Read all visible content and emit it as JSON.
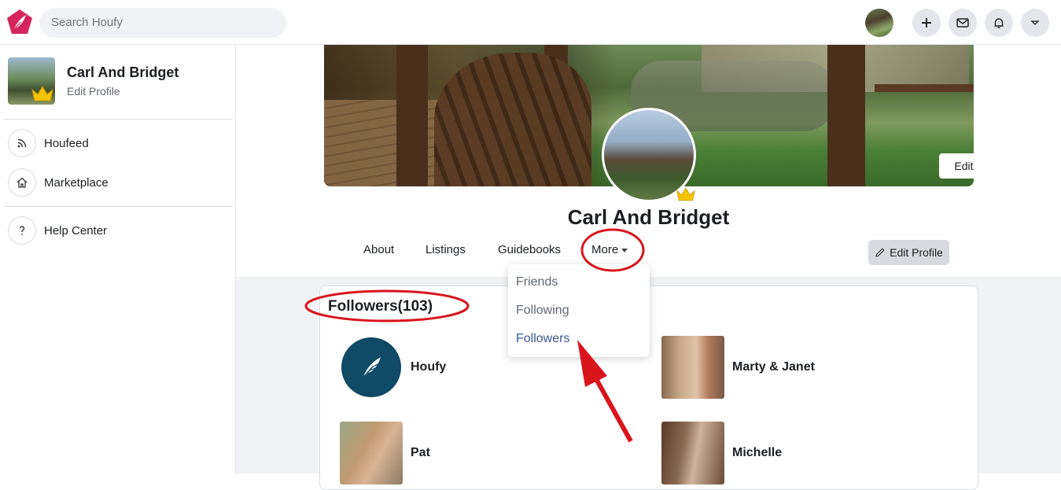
{
  "header": {
    "search_placeholder": "Search Houfy"
  },
  "sidebar": {
    "profile_name": "Carl And Bridget",
    "edit_profile": "Edit Profile",
    "items": [
      {
        "label": "Houfeed",
        "icon": "rss-icon"
      },
      {
        "label": "Marketplace",
        "icon": "home-icon"
      },
      {
        "label": "Help Center",
        "icon": "help-icon"
      }
    ]
  },
  "profile": {
    "name": "Carl And Bridget",
    "edit_cover_label": "Edit cover photo",
    "edit_profile_label": "Edit Profile",
    "tabs": [
      "About",
      "Listings",
      "Guidebooks"
    ],
    "more_label": "More"
  },
  "more_menu": {
    "items": [
      "Friends",
      "Following",
      "Followers"
    ],
    "active": "Followers"
  },
  "followers": {
    "title": "Followers(103)",
    "people": [
      {
        "name": "Houfy"
      },
      {
        "name": "Marty & Janet"
      },
      {
        "name": "Pat"
      },
      {
        "name": "Michelle"
      }
    ]
  },
  "colors": {
    "brand": "#d6245d",
    "link_active": "#385898",
    "annotation_red": "#d9141c"
  }
}
